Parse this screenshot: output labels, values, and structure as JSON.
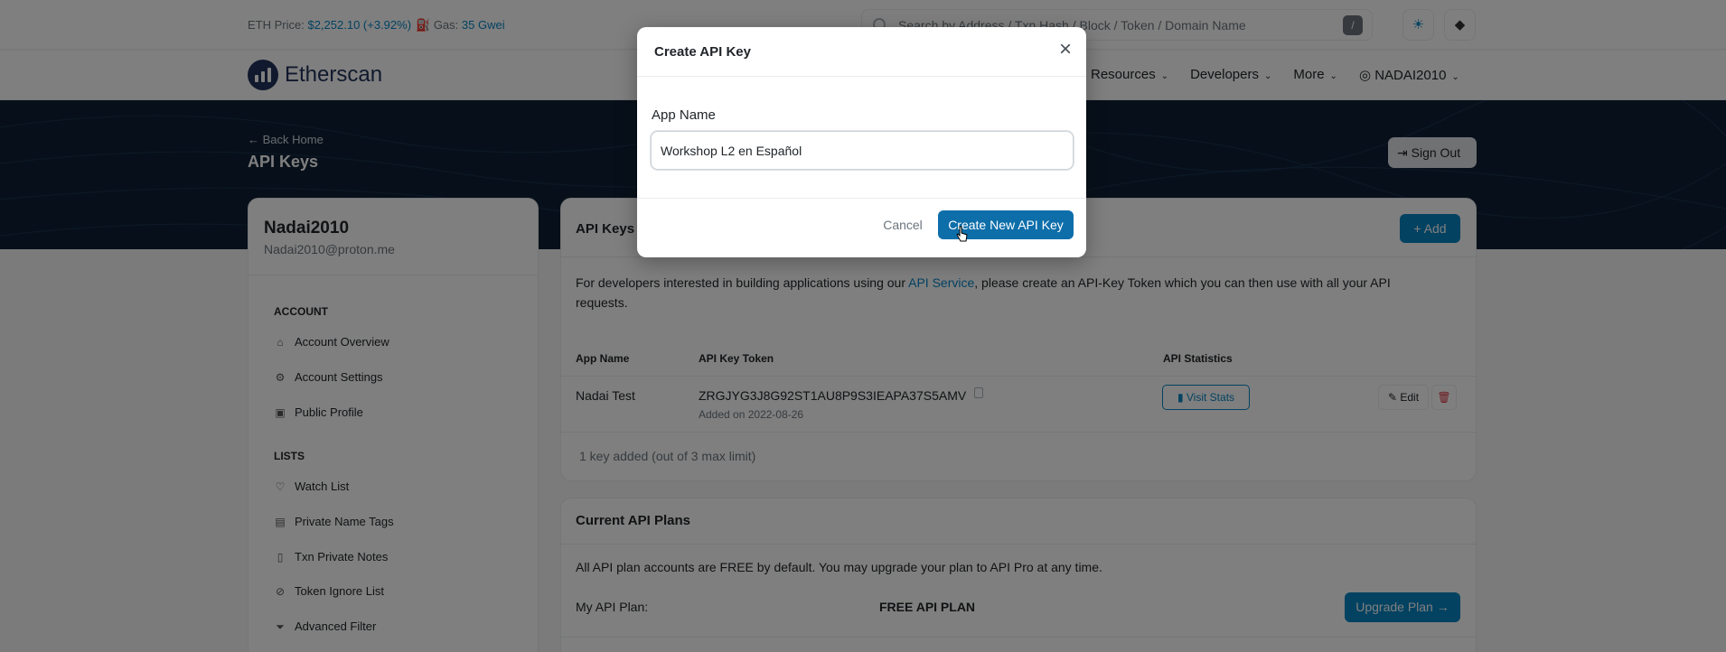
{
  "topbar": {
    "eth_price_label": "ETH Price:",
    "eth_price_value": "$2,252.10 (+3.92%)",
    "gas_label": "Gas:",
    "gas_value": "35 Gwei",
    "search_placeholder": "Search by Address / Txn Hash / Block / Token / Domain Name",
    "search_shortcut": "/"
  },
  "nav": {
    "logo_text": "Etherscan",
    "links": [
      "Resources",
      "Developers",
      "More"
    ],
    "user": "NADAI2010"
  },
  "hero": {
    "back_label": "Back Home",
    "title": "API Keys",
    "sign_out": "Sign Out"
  },
  "sidebar": {
    "username": "Nadai2010",
    "email": "Nadai2010@proton.me",
    "sections": [
      {
        "title": "ACCOUNT",
        "items": [
          "Account Overview",
          "Account Settings",
          "Public Profile"
        ]
      },
      {
        "title": "LISTS",
        "items": [
          "Watch List",
          "Private Name Tags",
          "Txn Private Notes",
          "Token Ignore List",
          "Advanced Filter"
        ]
      }
    ]
  },
  "api_keys_card": {
    "title": "API Keys",
    "add_label": "Add",
    "description_pre": "For developers interested in building applications using our ",
    "description_link": "API Service",
    "description_post": ", please create an API-Key Token which you can then use with all your API requests.",
    "columns": [
      "App Name",
      "API Key Token",
      "API Statistics"
    ],
    "rows": [
      {
        "app_name": "Nadai Test",
        "token": "ZRGJYG3J8G92ST1AU8P9S3IEAPA37S5AMV",
        "added": "Added on 2022-08-26",
        "stats_label": "Visit Stats",
        "edit_label": "Edit"
      }
    ],
    "footnote": "1 key added (out of 3 max limit)"
  },
  "plans_card": {
    "title": "Current API Plans",
    "description": "All API plan accounts are FREE by default. You may upgrade your plan to API Pro at any time.",
    "plan_label": "My API Plan:",
    "plan_value": "FREE API PLAN",
    "upgrade_label": "Upgrade Plan"
  },
  "modal": {
    "title": "Create API Key",
    "field_label": "App Name",
    "field_value": "Workshop L2 en Español",
    "cancel_label": "Cancel",
    "create_label": "Create New API Key"
  },
  "colors": {
    "accent": "#0784c3",
    "hero_bg": "#0e2135",
    "danger": "#dc3545"
  }
}
